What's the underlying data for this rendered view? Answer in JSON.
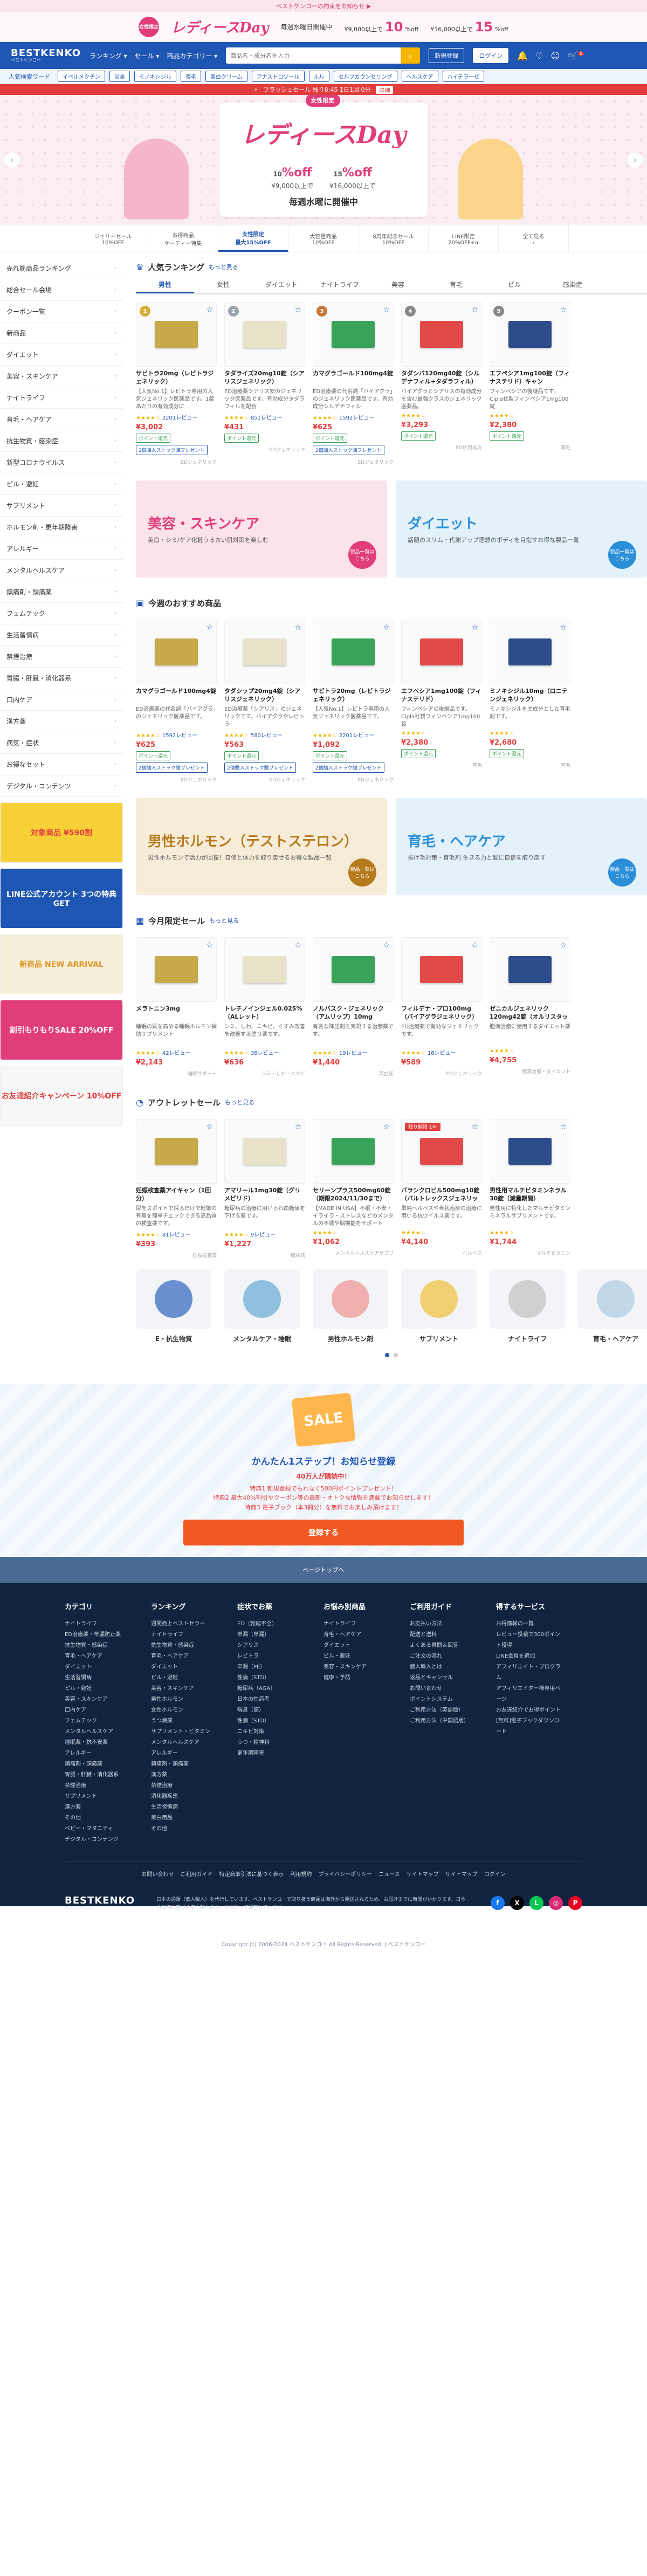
{
  "topbar": {
    "text": "ベストケンコーの約束をお知らせ ▶"
  },
  "promo": {
    "badge": "女性限定",
    "title": "レディースDay",
    "text": "毎週水曜日開催中",
    "offs": [
      {
        "cond": "¥9,000以上で",
        "value": "10",
        "unit": "%off"
      },
      {
        "cond": "¥16,000以上で",
        "value": "15",
        "unit": "%off"
      }
    ]
  },
  "header": {
    "logo": "BESTKENKO",
    "logo_sub": "ベストケンコー",
    "nav": [
      "ランキング ▾",
      "セール ▾",
      "商品カテゴリー ▾"
    ],
    "search_placeholder": "商品名・成分名を入力",
    "register": "新規登録",
    "login": "ログイン",
    "cart_count": "0"
  },
  "catbar": {
    "label": "人気検索ワード",
    "chips": [
      "イベルメクチン",
      "尖圭",
      "ミノキシジル",
      "薄毛",
      "美白クリーム",
      "アナストロゾール",
      "ルル",
      "セルフカウンセリング",
      "ヘルスケア",
      "ハイテラーゼ"
    ]
  },
  "flash": {
    "text": "フラッシュセール 残り8:45 1日1回 0分",
    "button": "詳細"
  },
  "hero": {
    "badge": "女性限定",
    "title": "レディースDay",
    "offs": [
      {
        "value": "10",
        "unit": "%off",
        "cond": "¥9,000以上で"
      },
      {
        "value": "15",
        "unit": "%off",
        "cond": "¥16,000以上で"
      }
    ],
    "date": "毎週水曜に開催中"
  },
  "strip": [
    {
      "title": "ジェリーセール",
      "sub": "10%OFF"
    },
    {
      "title": "お得商品",
      "sub": "ケーティー特集"
    },
    {
      "title": "女性限定",
      "sub": "最大15%OFF"
    },
    {
      "title": "大容量商品",
      "sub": "10%OFF"
    },
    {
      "title": "8周年記念セール",
      "sub": "10%OFF"
    },
    {
      "title": "LINE限定",
      "sub": "20%OFF+α"
    },
    {
      "title": "全て見る",
      "sub": "›"
    }
  ],
  "sidebar": {
    "items": [
      "売れ筋商品ランキング",
      "総合セール会場",
      "クーポン一覧",
      "新商品",
      "ダイエット",
      "美容・スキンケア",
      "ナイトライフ",
      "育毛・ヘアケア",
      "抗生物質・感染症",
      "新型コロナウイルス",
      "ピル・避妊",
      "サプリメント",
      "ホルモン剤・更年期障害",
      "アレルギー",
      "メンタルヘルスケア",
      "鎮痛剤・頭痛薬",
      "フェムテック",
      "生活習慣病",
      "禁煙治療",
      "胃腸・肝臓・消化器系",
      "口内ケア",
      "漢方薬",
      "病気・症状",
      "お得なセット",
      "デジタル・コンテンツ"
    ],
    "banners": [
      "対象商品 ¥590割",
      "LINE公式アカウント 3つの特典GET",
      "新商品 NEW ARRIVAL",
      "割引もりもりSALE 20%OFF",
      "お友達紹介キャンペーン 10%OFF"
    ]
  },
  "ranking": {
    "title": "人気ランキング",
    "more": "もっと見る",
    "tabs": [
      "男性",
      "女性",
      "ダイエット",
      "ナイトライフ",
      "美容",
      "育毛",
      "ピル",
      "感染症"
    ],
    "products": [
      {
        "rank": "1",
        "name": "サビトラ20mg（レビトラジェネリック）",
        "desc": "【人気No.1】レビトラ専用の人気ジェネリック医薬品です。1錠あたりの有効成分に",
        "stars": "★★★★☆",
        "reviews": "2201レビュー",
        "price": "¥3,002",
        "tag": "ポイント還元",
        "tag2": "2個購入ストック購プレゼント",
        "brand": "EDジェネリック"
      },
      {
        "rank": "2",
        "name": "タダライズ20mg10錠（シアリスジェネリック）",
        "desc": "ED治療薬シアリス安のジェネリック医薬品です。有効成分タダラフィルを配合",
        "stars": "★★★★☆",
        "reviews": "851レビュー",
        "price": "¥431",
        "tag": "ポイント還元",
        "tag2": "",
        "brand": "EDジェネリック"
      },
      {
        "rank": "3",
        "name": "カマグラゴールド100mg4錠",
        "desc": "ED治療薬の代名詞「バイアグラ」のジェネリック医薬品です。有効成分シルデナフィル",
        "stars": "★★★★☆",
        "reviews": "1592レビュー",
        "price": "¥625",
        "tag": "ポイント還元",
        "tag2": "2個購入ストック購プレゼント",
        "brand": "EDジェネリック"
      },
      {
        "rank": "4",
        "name": "タダシバ120mg40錠（シルデナフィル+タダラフィル）",
        "desc": "バイアグラとシアリスの有効成分を含む最強クラスのジェネリック医薬品。",
        "stars": "★★★★☆",
        "reviews": "",
        "price": "¥3,293",
        "tag": "ポイント還元",
        "tag2": "",
        "brand": "ED併用処方"
      },
      {
        "rank": "5",
        "name": "エフペシア1mg100錠（フィナステリド）キャン",
        "desc": "フィンペシアの後継品です。Cipla社製フィンペシア1mg100錠",
        "stars": "★★★★☆",
        "reviews": "",
        "price": "¥2,380",
        "tag": "ポイント還元",
        "tag2": "",
        "brand": "育毛"
      }
    ]
  },
  "banners1": [
    {
      "title": "美容・スキンケア",
      "text": "美白・シミ/ケア化粧うるおい肌対策を楽しむ",
      "btn": "製品一覧はこちら"
    },
    {
      "title": "ダイエット",
      "text": "話題のスリム・代謝アップ理想のボディを目指すお得な製品一覧",
      "btn": "製品一覧はこちら"
    }
  ],
  "recommend": {
    "title": "今週のおすすめ商品",
    "products": [
      {
        "name": "カマグラゴールド100mg4錠",
        "desc": "ED治療薬の代名詞「バイアグラ」のジェネリック医薬品です。",
        "stars": "★★★★☆",
        "reviews": "1592レビュー",
        "price": "¥625",
        "tag": "ポイント還元",
        "tag2": "2個購入ストック購プレゼント",
        "brand": "EDジェネリック"
      },
      {
        "name": "タダシップ20mg4錠（シアリスジェネリック）",
        "desc": "ED治療薬「シアリス」のジェネリックです。バイアグラやレビトラ",
        "stars": "★★★★☆",
        "reviews": "580レビュー",
        "price": "¥563",
        "tag": "ポイント還元",
        "tag2": "2個購入ストック購プレゼント",
        "brand": "EDジェネリック"
      },
      {
        "name": "サビトラ20mg（レビトラジェネリック）",
        "desc": "【人気No.1】レビトラ専用の人気ジェネリック医薬品です。",
        "stars": "★★★★☆",
        "reviews": "2201レビュー",
        "price": "¥1,092",
        "tag": "ポイント還元",
        "tag2": "2個購入ストック購プレゼント",
        "brand": "EDジェネリック"
      },
      {
        "name": "エフペシア1mg100錠（フィナステリド）",
        "desc": "フィンペシアの後継品です。Cipla社製フィンペシア1mg100錠",
        "stars": "★★★★☆",
        "reviews": "",
        "price": "¥2,380",
        "tag": "ポイント還元",
        "tag2": "",
        "brand": "育毛"
      },
      {
        "name": "ミノキシジル10mg（ロニテンジェネリック）",
        "desc": "ミノキシジルを主成分とした育毛剤です。",
        "stars": "★★★★☆",
        "reviews": "",
        "price": "¥2,680",
        "tag": "ポイント還元",
        "tag2": "",
        "brand": "育毛"
      }
    ]
  },
  "banners2": [
    {
      "title": "男性ホルモン（テストステロン）",
      "text": "男性ホルモンで活力が回復！自信と体力を取り戻せるお得な製品一覧",
      "btn": "製品一覧はこちら"
    },
    {
      "title": "育毛・ヘアケア",
      "text": "抜け毛対策・育毛剤 生きる力と髪に自信を取り戻す",
      "btn": "製品一覧はこちら"
    }
  ],
  "monthly": {
    "title": "今月限定セール",
    "more": "もっと見る",
    "products": [
      {
        "name": "メラトニン3mg",
        "desc": "睡眠の質を高める睡眠ホルモン補助サプリメント",
        "stars": "★★★★☆",
        "reviews": "42レビュー",
        "price": "¥2,143",
        "brand": "睡眠サポート"
      },
      {
        "name": "トレチノインジェル0.025%（ALレット）",
        "desc": "シミ、しわ、ニキビ、くすみ改善を改善する塗り薬です。",
        "stars": "★★★★☆",
        "reviews": "38レビュー",
        "price": "¥636",
        "brand": "シミ・しわ・ニキビ"
      },
      {
        "name": "ノルバスク・ジェネリック（アムリップ）10mg",
        "desc": "有名な降圧剤を実現する治療薬です。",
        "stars": "★★★★☆",
        "reviews": "19レビュー",
        "price": "¥1,440",
        "brand": "高血圧"
      },
      {
        "name": "フィルデナ・プロ100mg（バイアグラジェネリック）",
        "desc": "ED治療薬で有効なジェネリックです。",
        "stars": "★★★★☆",
        "reviews": "18レビュー",
        "price": "¥589",
        "brand": "EDジェネリック"
      },
      {
        "name": "ゼニカルジェネリック120mg42錠（オルリスタット）",
        "desc": "肥満治療に使用するダイエット薬",
        "stars": "★★★★☆",
        "reviews": "",
        "price": "¥4,755",
        "brand": "肥満治療・ダイエット"
      }
    ]
  },
  "outlet": {
    "title": "アウトレットセール",
    "more": "もっと見る",
    "products": [
      {
        "name": "妊娠検査薬アイキャン（1回分）",
        "desc": "尿をスポイトで採るだけで妊娠の有無を簡単チェックできる高品質の検査薬です。",
        "stars": "★★★★☆",
        "reviews": "81レビュー",
        "price": "¥393",
        "brand": "妊娠検査薬",
        "badge": ""
      },
      {
        "name": "アマリール1mg30錠（グリメピリド）",
        "desc": "糖尿病の治療に用いられ血糖値を下げる薬です。",
        "stars": "★★★★☆",
        "reviews": "9レビュー",
        "price": "¥1,227",
        "brand": "糖尿病",
        "badge": ""
      },
      {
        "name": "セリーンプラス500mg60錠（期限2024/11/30まで）",
        "desc": "【MADE IN USA】不眠・不安・イライラ・ストレスなどのメンタルの不調や脳機能をサポート",
        "stars": "★★★★☆",
        "reviews": "",
        "price": "¥1,062",
        "brand": "メンタルヘルスケアサプリ",
        "badge": ""
      },
      {
        "name": "バラシクロビル500mg10錠（バルトレックスジェネリック）",
        "desc": "単純ヘルペスや帯状疱疹の治療に用いる抗ウイルス薬です。",
        "stars": "★★★★☆",
        "reviews": "",
        "price": "¥4,140",
        "brand": "ヘルペス",
        "badge": "残り期限 1年"
      },
      {
        "name": "男性用マルチビタミンネラル30錠（減量期間）",
        "desc": "男性用に特化したマルチビタミンミネラルサプリメントです。",
        "stars": "★★★★☆",
        "reviews": "",
        "price": "¥1,744",
        "brand": "マルチビタミン",
        "badge": ""
      }
    ]
  },
  "categories": [
    "E・抗生物質",
    "メンタルケア・睡眠",
    "男性ホルモン剤",
    "サプリメント",
    "ナイトライフ",
    "育毛・ヘアケア",
    "美容"
  ],
  "newsletter": {
    "icon": "SALE",
    "title": "かんたん1ステップ！お知らせ登録",
    "sub": "40万人が購読中！",
    "lines": [
      "特典1 新規登録でもれなく500円ポイントプレゼント！",
      "特典2 最大40%割引やクーポン等の最新・オトクな情報を満載でお知らせします！",
      "特典3 電子ブック（本3冊分）を無料でお楽しみ頂けます！"
    ],
    "button": "登録する"
  },
  "pagetop": "ページトップへ",
  "footer": {
    "cols": [
      {
        "title": "カテゴリ",
        "links": [
          "ナイトライフ",
          "ED治療薬・早漏防止薬",
          "抗生物質・感染症",
          "育毛・ヘアケア",
          "ダイエット",
          "生活習慣病",
          "ピル・避妊",
          "美容・スキンケア",
          "口内ケア",
          "フェムテック",
          "メンタルヘルスケア",
          "睡眠薬・抗不安薬",
          "アレルギー",
          "鎮痛剤・頭痛薬",
          "胃腸・肝臓・消化器系",
          "禁煙治療",
          "サプリメント",
          "漢方薬",
          "その他",
          "ペピー・マタニティ",
          "デジタル・コンテンツ"
        ]
      },
      {
        "title": "ランキング",
        "links": [
          "週間売上ベストセラー",
          "ナイトライフ",
          "抗生物質・感染症",
          "育毛・ヘアケア",
          "ダイエット",
          "ピル・避妊",
          "美容・スキンケア",
          "男性ホルモン",
          "女性ホルモン",
          "うつ病薬",
          "サプリメント・ビタミン",
          "メンタルヘルスケア",
          "アレルギー",
          "鎮痛剤・頭痛薬",
          "漢方薬",
          "禁煙治療",
          "消化器疾患",
          "生活習慣病",
          "美白用品",
          "その他"
        ]
      },
      {
        "title": "症状でお薬",
        "links": [
          "ED（勃起不全）",
          "早漏（早漏）",
          "シアリス",
          "レビトラ",
          "早漏（PE）",
          "性病（STD）",
          "糖尿病（AGA）",
          "日本の性病考",
          "喘息（癌）",
          "性病（STD）",
          "ニキビ対策",
          "うつ・精神科",
          "更年期障害"
        ]
      },
      {
        "title": "お悩み別商品",
        "links": [
          "ナイトライフ",
          "育毛・ヘアケア",
          "ダイエット",
          "ピル・避妊",
          "美容・スキンケア",
          "健康・予防"
        ]
      },
      {
        "title": "ご利用ガイド",
        "links": [
          "お支払い方法",
          "配送と送料",
          "よくある質問＆回答",
          "ご注文の流れ",
          "個人輸入とは",
          "返品とキャンセル",
          "お問い合わせ",
          "ポイントシステム",
          "ご利用方法（英語版）",
          "ご利用方法（中国語版）"
        ]
      },
      {
        "title": "得するサービス",
        "links": [
          "お得情報の一覧",
          "レビュー投稿で300ポイント獲得",
          "LINE会員を追加",
          "アフィリエイト・プログラム",
          "アフィリエイター様専用ページ",
          "お友達紹介でお得ポイント",
          "[無料]電子ブックダウンロード"
        ]
      }
    ],
    "links": [
      "お問い合わせ",
      "ご利用ガイド",
      "特定商取引法に基づく表示",
      "利用規約",
      "プライバシーポリシー",
      "ニュース",
      "サイトマップ",
      "サイトマップ",
      "ログイン"
    ],
    "logo": "BESTKENKO",
    "logo_sub": "ベストケンコー",
    "desc": "日本の通販（個人輸入）を代行しています。ベストケンコーで取り扱う商品は海外から発送されるため、お届けまでに時間がかかります。日本の法律に基づく個人輸入のルールに則って運営しています。",
    "copyright": "Copyright (c) 2006-2024 ベストケンコー All Rights Reserved. | ベストケンコー"
  }
}
